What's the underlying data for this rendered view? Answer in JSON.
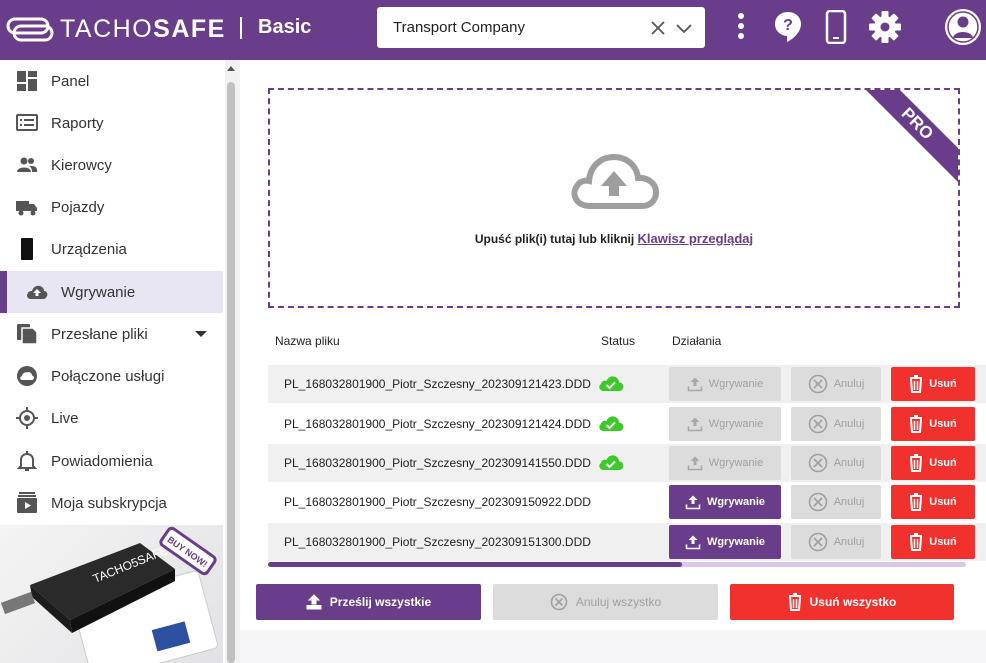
{
  "header": {
    "brand_light": "TACHO",
    "brand_bold": "SAFE",
    "plan": "Basic",
    "company_select": {
      "value": "Transport Company"
    },
    "icons": [
      "more-vert-icon",
      "help-icon",
      "phone-icon",
      "settings-icon",
      "account-icon"
    ]
  },
  "sidebar": {
    "items": [
      {
        "label": "Panel",
        "icon": "dashboard-icon"
      },
      {
        "label": "Raporty",
        "icon": "reports-icon"
      },
      {
        "label": "Kierowcy",
        "icon": "drivers-icon"
      },
      {
        "label": "Pojazdy",
        "icon": "truck-icon"
      },
      {
        "label": "Urządzenia",
        "icon": "device-icon"
      },
      {
        "label": "Wgrywanie",
        "icon": "cloud-upload-icon",
        "active": true
      },
      {
        "label": "Przesłane pliki",
        "icon": "files-icon",
        "expandable": true
      },
      {
        "label": "Połączone usługi",
        "icon": "cloud-icon"
      },
      {
        "label": "Live",
        "icon": "location-icon"
      },
      {
        "label": "Powiadomienia",
        "icon": "bell-icon"
      },
      {
        "label": "Moja subskrypcja",
        "icon": "subscription-icon"
      }
    ],
    "promo": {
      "badge": "BUY NOW!",
      "brand": "TACHO5SAFE"
    }
  },
  "dropzone": {
    "ribbon": "PRO",
    "text": "Upuść plik(i) tutaj lub kliknij",
    "link": "Klawisz przeglądaj"
  },
  "table": {
    "columns": [
      "Nazwa pliku",
      "Status",
      "Działania"
    ],
    "rows": [
      {
        "file": "PL_168032801900_Piotr_Szczesny_202309121423.DDD",
        "uploaded": true
      },
      {
        "file": "PL_168032801900_Piotr_Szczesny_202309121424.DDD",
        "uploaded": true
      },
      {
        "file": "PL_168032801900_Piotr_Szczesny_202309141550.DDD",
        "uploaded": true
      },
      {
        "file": "PL_168032801900_Piotr_Szczesny_202309150922.DDD",
        "uploaded": false
      },
      {
        "file": "PL_168032801900_Piotr_Szczesny_202309151300.DDD",
        "uploaded": false
      }
    ],
    "actions": {
      "upload": "Wgrywanie",
      "cancel": "Anuluj",
      "delete": "Usuń"
    }
  },
  "bottom_actions": {
    "send_all": "Prześlij wszystkie",
    "cancel_all": "Anuluj wszystko",
    "delete_all": "Usuń wszystko"
  },
  "colors": {
    "brand": "#6a3d8a",
    "danger": "#f0312d",
    "success": "#3ec92b",
    "disabled": "#dcdcdc"
  }
}
